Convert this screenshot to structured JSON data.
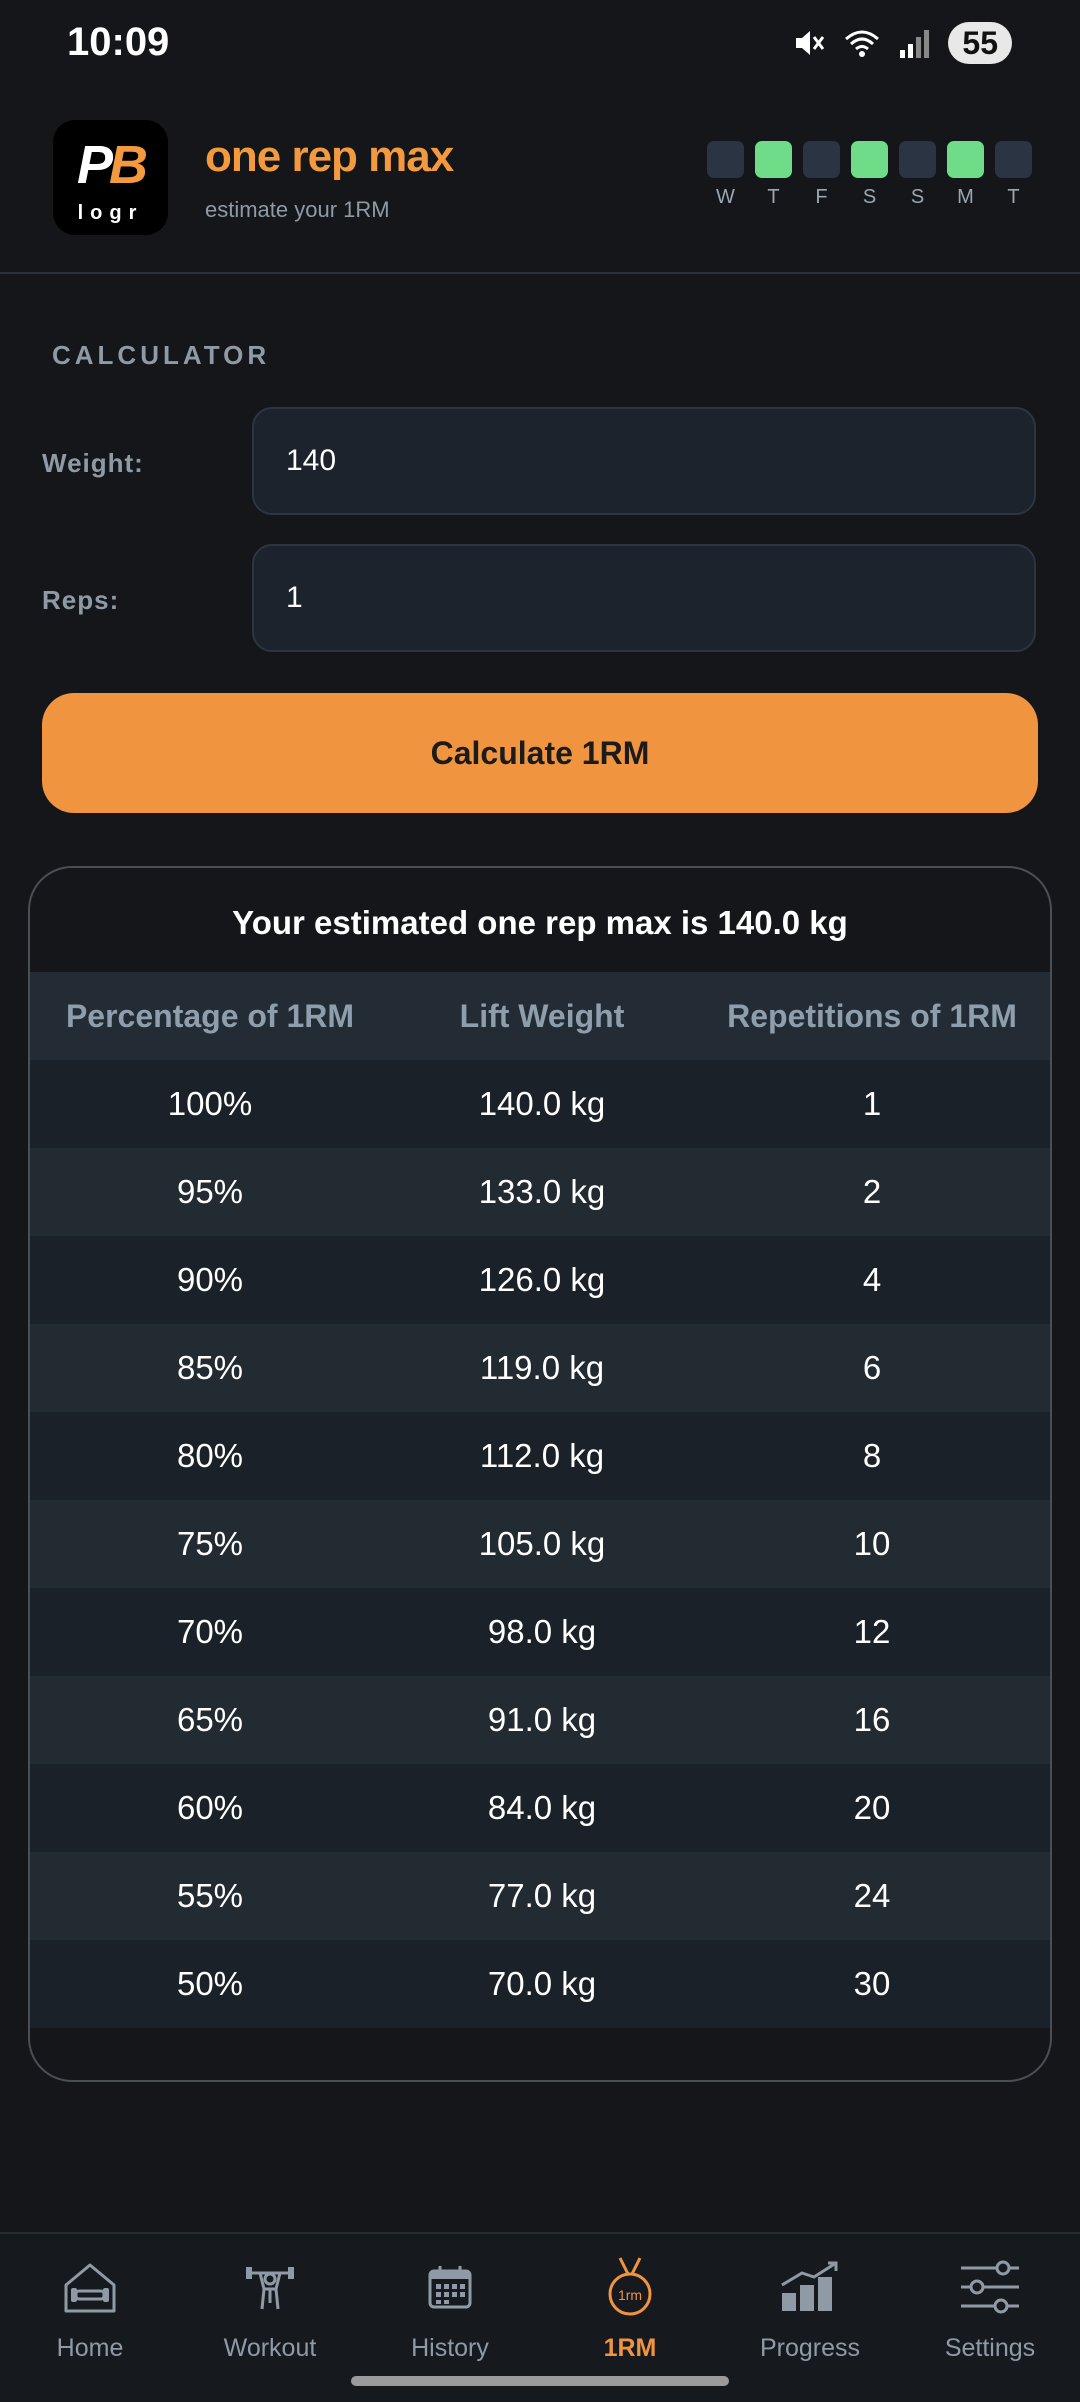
{
  "status_bar": {
    "time": "10:09",
    "battery": "55"
  },
  "header": {
    "logo_text": "PB",
    "logo_sub": "logr",
    "title": "one rep max",
    "subtitle": "estimate your 1RM",
    "week": [
      {
        "label": "W",
        "active": false
      },
      {
        "label": "T",
        "active": true
      },
      {
        "label": "F",
        "active": false
      },
      {
        "label": "S",
        "active": true
      },
      {
        "label": "S",
        "active": false
      },
      {
        "label": "M",
        "active": true
      },
      {
        "label": "T",
        "active": false
      }
    ],
    "colors": {
      "accent": "#f39a3e",
      "active_day": "#6fdc8a",
      "inactive_day": "#2b3442"
    }
  },
  "calculator": {
    "section_title": "CALCULATOR",
    "weight_label": "Weight:",
    "weight_value": "140",
    "reps_label": "Reps:",
    "reps_value": "1",
    "button_label": "Calculate 1RM"
  },
  "results": {
    "summary": "Your estimated one rep max is 140.0 kg",
    "headers": [
      "Percentage of 1RM",
      "Lift Weight",
      "Repetitions of 1RM"
    ],
    "rows": [
      [
        "100%",
        "140.0 kg",
        "1"
      ],
      [
        "95%",
        "133.0 kg",
        "2"
      ],
      [
        "90%",
        "126.0 kg",
        "4"
      ],
      [
        "85%",
        "119.0 kg",
        "6"
      ],
      [
        "80%",
        "112.0 kg",
        "8"
      ],
      [
        "75%",
        "105.0 kg",
        "10"
      ],
      [
        "70%",
        "98.0 kg",
        "12"
      ],
      [
        "65%",
        "91.0 kg",
        "16"
      ],
      [
        "60%",
        "84.0 kg",
        "20"
      ],
      [
        "55%",
        "77.0 kg",
        "24"
      ],
      [
        "50%",
        "70.0 kg",
        "30"
      ]
    ]
  },
  "nav": {
    "items": [
      {
        "label": "Home",
        "icon": "home-icon",
        "active": false
      },
      {
        "label": "Workout",
        "icon": "workout-icon",
        "active": false
      },
      {
        "label": "History",
        "icon": "calendar-icon",
        "active": false
      },
      {
        "label": "1RM",
        "icon": "medal-icon",
        "active": true
      },
      {
        "label": "Progress",
        "icon": "progress-chart-icon",
        "active": false
      },
      {
        "label": "Settings",
        "icon": "sliders-icon",
        "active": false
      }
    ]
  }
}
